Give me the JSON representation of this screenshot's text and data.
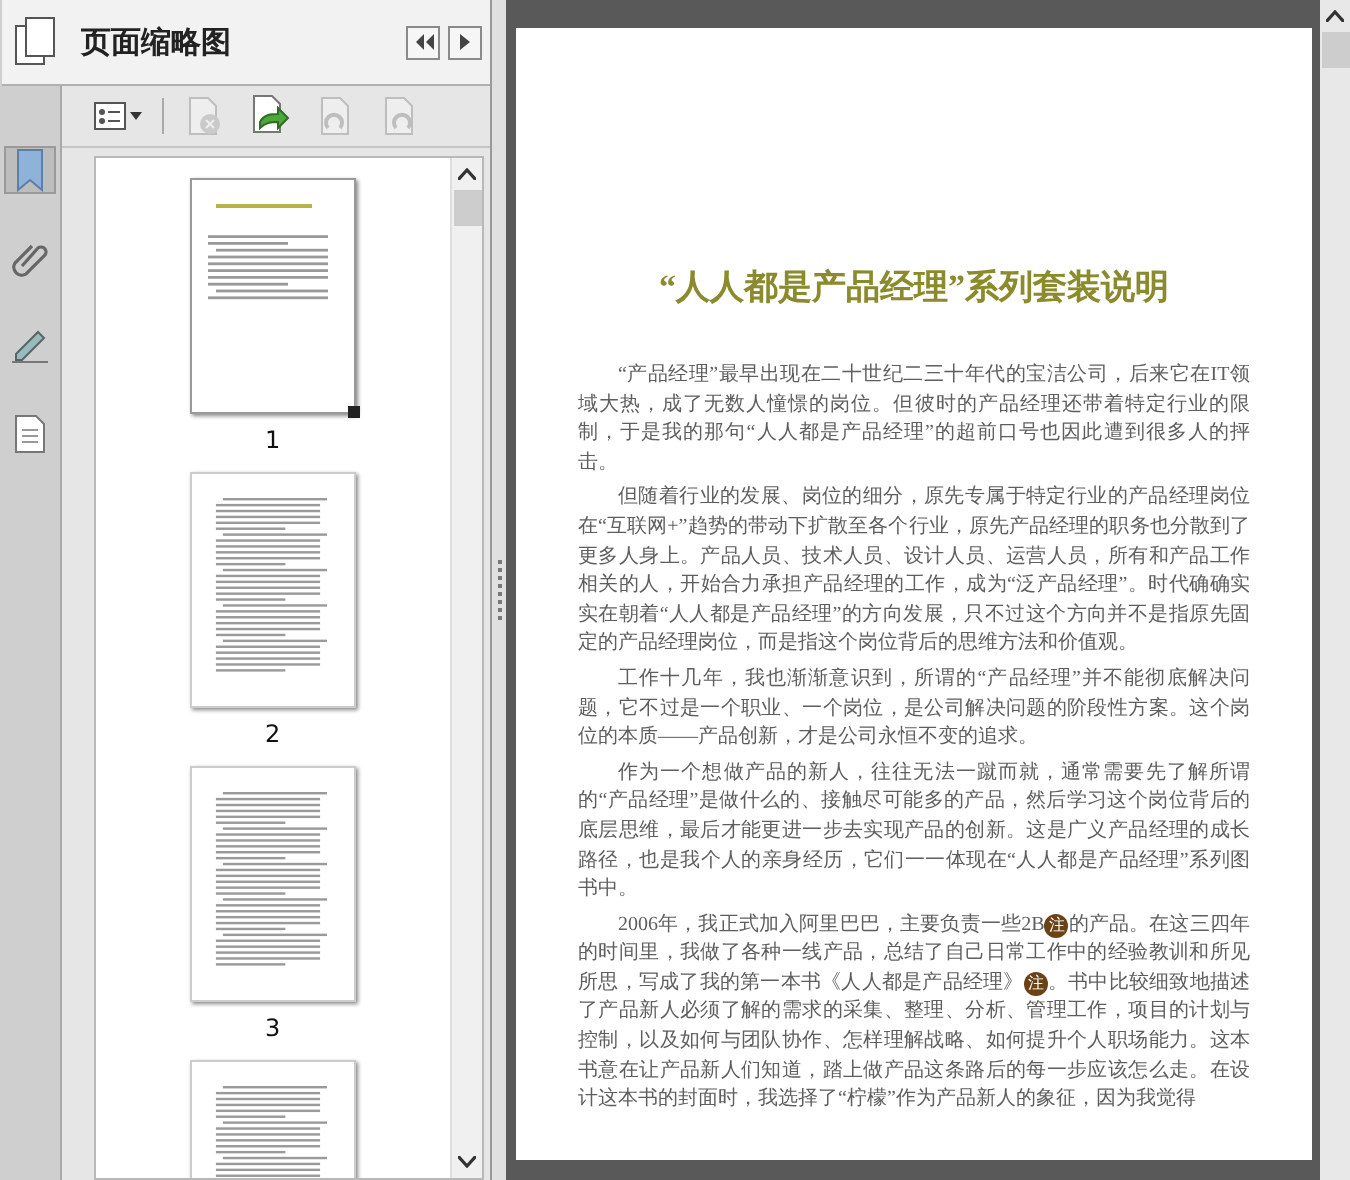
{
  "side_rail": [
    {
      "kind": "bookmark",
      "selected": true
    },
    {
      "kind": "attachment",
      "selected": false
    },
    {
      "kind": "signature",
      "selected": false
    },
    {
      "kind": "document",
      "selected": false
    }
  ],
  "panel": {
    "title": "页面缩略图",
    "toolbar": [
      {
        "kind": "options",
        "disabled": false
      },
      {
        "kind": "delete",
        "disabled": true
      },
      {
        "kind": "insert",
        "disabled": false
      },
      {
        "kind": "rotate-left",
        "disabled": true
      },
      {
        "kind": "rotate-right",
        "disabled": true
      }
    ],
    "thumbnails": [
      {
        "label": "1",
        "selected": true,
        "kind": "title-page"
      },
      {
        "label": "2",
        "selected": false,
        "kind": "text-page"
      },
      {
        "label": "3",
        "selected": false,
        "kind": "text-page"
      },
      {
        "selected": false,
        "kind": "text-page"
      }
    ]
  },
  "document": {
    "title": "“人人都是产品经理”系列套装说明",
    "paragraphs": [
      [
        {
          "kind": "text",
          "text": "“产品经理”最早出现在二十世纪二三十年代的宝洁公司，后来它在IT领域大热，成了无数人憧憬的岗位。但彼时的产品经理还带着特定行业的限制，于是我的那句“人人都是产品经理”的超前口号也因此遭到很多人的抨击。"
        }
      ],
      [
        {
          "kind": "text",
          "text": "但随着行业的发展、岗位的细分，原先专属于特定行业的产品经理岗位在“互联网+”趋势的带动下扩散至各个行业，原先产品经理的职务也分散到了更多人身上。产品人员、技术人员、设计人员、运营人员，所有和产品工作相关的人，开始合力承担产品经理的工作，成为“泛产品经理”。时代确确实实在朝着“人人都是产品经理”的方向发展，只不过这个方向并不是指原先固定的产品经理岗位，而是指这个岗位背后的思维方法和价值观。"
        }
      ],
      [
        {
          "kind": "text",
          "text": "工作十几年，我也渐渐意识到，所谓的“产品经理”并不能彻底解决问题，它不过是一个职业、一个岗位，是公司解决问题的阶段性方案。这个岗位的本质——产品创新，才是公司永恒不变的追求。"
        }
      ],
      [
        {
          "kind": "text",
          "text": "作为一个想做产品的新人，往往无法一蹴而就，通常需要先了解所谓的“产品经理”是做什么的、接触尽可能多的产品，然后学习这个岗位背后的底层思维，最后才能更进一步去实现产品的创新。这是广义产品经理的成长路径，也是我个人的亲身经历，它们一一体现在“人人都是产品经理”系列图书中。"
        }
      ],
      [
        {
          "kind": "text",
          "text": "2006年，我正式加入阿里巴巴，主要负责一些2B"
        },
        {
          "kind": "note",
          "text": "注"
        },
        {
          "kind": "text",
          "text": "的产品。在这三四年的时间里，我做了各种一线产品，总结了自己日常工作中的经验教训和所见所思，写成了我的第一本书《人人都是产品经理》"
        },
        {
          "kind": "note",
          "text": "注"
        },
        {
          "kind": "text",
          "text": "。书中比较细致地描述了产品新人必须了解的需求的采集、整理、分析、管理工作，项目的计划与控制，以及如何与团队协作、怎样理解战略、如何提升个人职场能力。这本书意在让产品新人们知道，踏上做产品这条路后的每一步应该怎么走。在设计这本书的封面时，我选择了“柠檬”作为产品新人的象征，因为我觉得"
        }
      ]
    ]
  }
}
